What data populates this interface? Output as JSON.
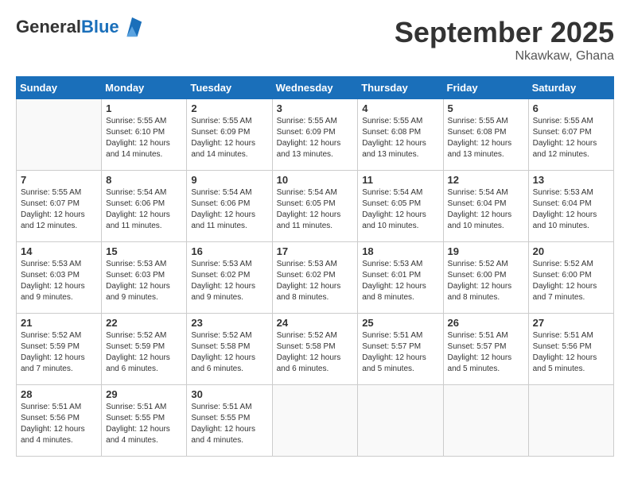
{
  "logo": {
    "general": "General",
    "blue": "Blue"
  },
  "header": {
    "month": "September 2025",
    "location": "Nkawkaw, Ghana"
  },
  "weekdays": [
    "Sunday",
    "Monday",
    "Tuesday",
    "Wednesday",
    "Thursday",
    "Friday",
    "Saturday"
  ],
  "weeks": [
    [
      {
        "day": "",
        "info": ""
      },
      {
        "day": "1",
        "info": "Sunrise: 5:55 AM\nSunset: 6:10 PM\nDaylight: 12 hours\nand 14 minutes."
      },
      {
        "day": "2",
        "info": "Sunrise: 5:55 AM\nSunset: 6:09 PM\nDaylight: 12 hours\nand 14 minutes."
      },
      {
        "day": "3",
        "info": "Sunrise: 5:55 AM\nSunset: 6:09 PM\nDaylight: 12 hours\nand 13 minutes."
      },
      {
        "day": "4",
        "info": "Sunrise: 5:55 AM\nSunset: 6:08 PM\nDaylight: 12 hours\nand 13 minutes."
      },
      {
        "day": "5",
        "info": "Sunrise: 5:55 AM\nSunset: 6:08 PM\nDaylight: 12 hours\nand 13 minutes."
      },
      {
        "day": "6",
        "info": "Sunrise: 5:55 AM\nSunset: 6:07 PM\nDaylight: 12 hours\nand 12 minutes."
      }
    ],
    [
      {
        "day": "7",
        "info": "Sunrise: 5:55 AM\nSunset: 6:07 PM\nDaylight: 12 hours\nand 12 minutes."
      },
      {
        "day": "8",
        "info": "Sunrise: 5:54 AM\nSunset: 6:06 PM\nDaylight: 12 hours\nand 11 minutes."
      },
      {
        "day": "9",
        "info": "Sunrise: 5:54 AM\nSunset: 6:06 PM\nDaylight: 12 hours\nand 11 minutes."
      },
      {
        "day": "10",
        "info": "Sunrise: 5:54 AM\nSunset: 6:05 PM\nDaylight: 12 hours\nand 11 minutes."
      },
      {
        "day": "11",
        "info": "Sunrise: 5:54 AM\nSunset: 6:05 PM\nDaylight: 12 hours\nand 10 minutes."
      },
      {
        "day": "12",
        "info": "Sunrise: 5:54 AM\nSunset: 6:04 PM\nDaylight: 12 hours\nand 10 minutes."
      },
      {
        "day": "13",
        "info": "Sunrise: 5:53 AM\nSunset: 6:04 PM\nDaylight: 12 hours\nand 10 minutes."
      }
    ],
    [
      {
        "day": "14",
        "info": "Sunrise: 5:53 AM\nSunset: 6:03 PM\nDaylight: 12 hours\nand 9 minutes."
      },
      {
        "day": "15",
        "info": "Sunrise: 5:53 AM\nSunset: 6:03 PM\nDaylight: 12 hours\nand 9 minutes."
      },
      {
        "day": "16",
        "info": "Sunrise: 5:53 AM\nSunset: 6:02 PM\nDaylight: 12 hours\nand 9 minutes."
      },
      {
        "day": "17",
        "info": "Sunrise: 5:53 AM\nSunset: 6:02 PM\nDaylight: 12 hours\nand 8 minutes."
      },
      {
        "day": "18",
        "info": "Sunrise: 5:53 AM\nSunset: 6:01 PM\nDaylight: 12 hours\nand 8 minutes."
      },
      {
        "day": "19",
        "info": "Sunrise: 5:52 AM\nSunset: 6:00 PM\nDaylight: 12 hours\nand 8 minutes."
      },
      {
        "day": "20",
        "info": "Sunrise: 5:52 AM\nSunset: 6:00 PM\nDaylight: 12 hours\nand 7 minutes."
      }
    ],
    [
      {
        "day": "21",
        "info": "Sunrise: 5:52 AM\nSunset: 5:59 PM\nDaylight: 12 hours\nand 7 minutes."
      },
      {
        "day": "22",
        "info": "Sunrise: 5:52 AM\nSunset: 5:59 PM\nDaylight: 12 hours\nand 6 minutes."
      },
      {
        "day": "23",
        "info": "Sunrise: 5:52 AM\nSunset: 5:58 PM\nDaylight: 12 hours\nand 6 minutes."
      },
      {
        "day": "24",
        "info": "Sunrise: 5:52 AM\nSunset: 5:58 PM\nDaylight: 12 hours\nand 6 minutes."
      },
      {
        "day": "25",
        "info": "Sunrise: 5:51 AM\nSunset: 5:57 PM\nDaylight: 12 hours\nand 5 minutes."
      },
      {
        "day": "26",
        "info": "Sunrise: 5:51 AM\nSunset: 5:57 PM\nDaylight: 12 hours\nand 5 minutes."
      },
      {
        "day": "27",
        "info": "Sunrise: 5:51 AM\nSunset: 5:56 PM\nDaylight: 12 hours\nand 5 minutes."
      }
    ],
    [
      {
        "day": "28",
        "info": "Sunrise: 5:51 AM\nSunset: 5:56 PM\nDaylight: 12 hours\nand 4 minutes."
      },
      {
        "day": "29",
        "info": "Sunrise: 5:51 AM\nSunset: 5:55 PM\nDaylight: 12 hours\nand 4 minutes."
      },
      {
        "day": "30",
        "info": "Sunrise: 5:51 AM\nSunset: 5:55 PM\nDaylight: 12 hours\nand 4 minutes."
      },
      {
        "day": "",
        "info": ""
      },
      {
        "day": "",
        "info": ""
      },
      {
        "day": "",
        "info": ""
      },
      {
        "day": "",
        "info": ""
      }
    ]
  ]
}
